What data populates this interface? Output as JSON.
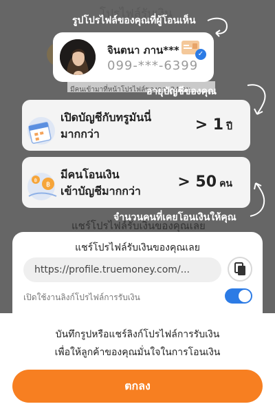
{
  "background": {
    "ghost_title": "โปรไฟล์รับเงิน",
    "ghost_bar_text": "มีคนเข้ามาที่หน้าโปรไฟล์ของคุณ 24 คน",
    "ghost_share_text": "แชร์โปรไฟล์รับเงินของคุณเลย"
  },
  "captions": {
    "profile_caption": "รูปโปรไฟล์ของคุณที่ผู้โอนเห็น",
    "age_caption": "อายุบัญชีของคุณ",
    "transfer_caption": "จำนวนคนที่เคยโอนเงินให้คุณ"
  },
  "profile": {
    "name": "จินตนา ภาน***",
    "phone": "099-***-6399"
  },
  "stats": {
    "account_age": {
      "label_line1": "เปิดบัญชีกับทรูมันนี่",
      "label_line2": "มากกว่า",
      "value": "> 1",
      "unit": "ปี"
    },
    "transfers": {
      "label_line1": "มีคนโอนเงิน",
      "label_line2": "เข้าบัญชีมากกว่า",
      "value": "> 50",
      "unit": "คน"
    }
  },
  "share": {
    "title": "แชร์โปรไฟล์รับเงินของคุณเลย",
    "link": "https://profile.truemoney.com/...",
    "toggle_label": "เปิดใช้งานลิงก์โปรไฟล์การรับเงิน",
    "toggle_on": true
  },
  "sheet": {
    "line1": "บันทึกรูปหรือแชร์ลิงก์โปรไฟล์การรับเงิน",
    "line2": "เพื่อให้ลูกค้าของคุณมั่นใจในการโอนเงิน",
    "button": "ตกลง"
  },
  "colors": {
    "accent": "#f77f21",
    "toggle": "#2c7be5",
    "overlay": "#666666"
  },
  "icons": [
    "calendar-icon",
    "coins-icon",
    "copy-icon",
    "id-card-icon",
    "verified-check-icon"
  ]
}
